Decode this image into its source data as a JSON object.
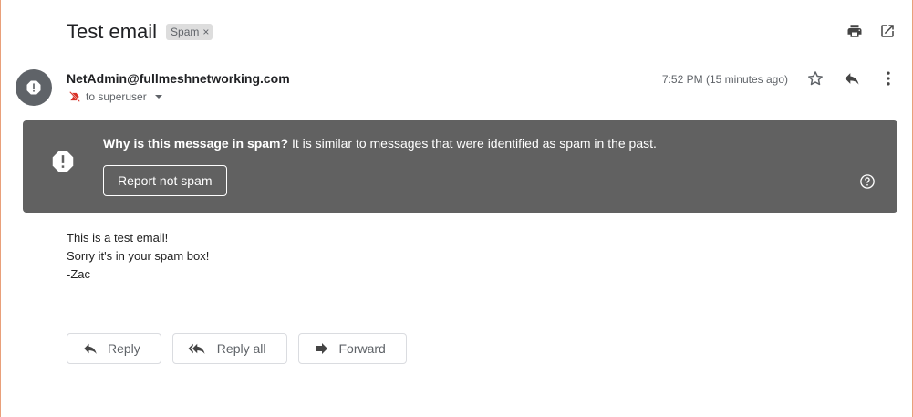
{
  "email": {
    "subject": "Test email",
    "label": "Spam",
    "label_remove": "×",
    "sender": "NetAdmin@fullmeshnetworking.com",
    "to": "to superuser",
    "timestamp": "7:52 PM (15 minutes ago)"
  },
  "spam_banner": {
    "question": "Why is this message in spam?",
    "explanation": " It is similar to messages that were identified as spam in the past.",
    "button_label": "Report not spam"
  },
  "body_lines": [
    "This is a test email!",
    "Sorry it's in your spam box!",
    "-Zac"
  ],
  "actions": {
    "reply_label": "Reply",
    "reply_all_label": "Reply all",
    "forward_label": "Forward"
  },
  "icons": {
    "print": "print-icon",
    "open_new_window": "open-in-new-icon",
    "star": "star-icon",
    "reply": "reply-icon",
    "more": "more-vert-icon",
    "avatar": "warning-icon",
    "help": "help-icon",
    "important_off": "important-off-icon"
  },
  "colors": {
    "banner_bg": "#616161",
    "avatar_bg": "#5f6368",
    "text_primary": "#202124",
    "text_secondary": "#5f6368"
  }
}
